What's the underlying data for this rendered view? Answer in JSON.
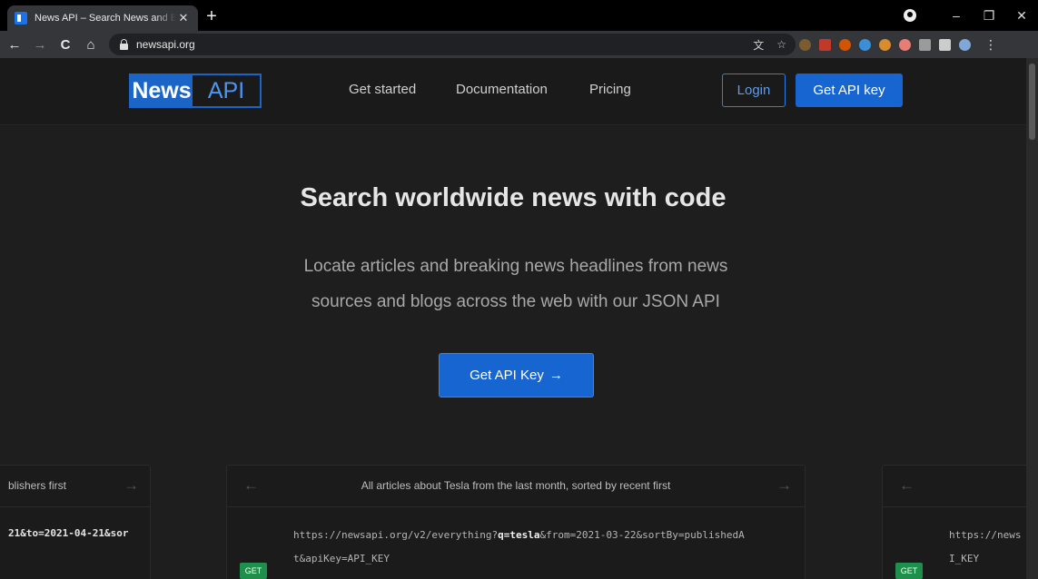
{
  "browser": {
    "tab_title": "News API – Search News and Blog articles on the web",
    "tab_close": "✕",
    "new_tab": "+",
    "url": "newsapi.org",
    "back": "←",
    "forward": "→",
    "reload": "C",
    "home": "⌂",
    "minimize": "–",
    "restore": "❐",
    "close": "✕",
    "translate_icon": "文",
    "star_icon": "☆",
    "menu": "⋮",
    "extension_colors": [
      "#7a5c2e",
      "#c0392b",
      "#d35400",
      "#3a8fd8",
      "#d98c2b",
      "#e67e73",
      "#9b9b9b",
      "#cccccc",
      "#7fa7d9"
    ]
  },
  "header": {
    "logo_news": "News",
    "logo_api": "API",
    "nav": [
      "Get started",
      "Documentation",
      "Pricing"
    ],
    "login": "Login",
    "get_api_key": "Get API key"
  },
  "hero": {
    "title": "Search worldwide news with code",
    "subtitle_line1": "Locate articles and breaking news headlines from news",
    "subtitle_line2": "sources and blogs across the web with our JSON API",
    "cta": "Get API Key",
    "cta_arrow": "→"
  },
  "examples": {
    "left": {
      "title": "blishers first",
      "arrow_right": "→",
      "code": "21&to=2021-04-21&sor"
    },
    "main": {
      "title": "All articles about Tesla from the last month, sorted by recent first",
      "arrow_left": "←",
      "arrow_right": "→",
      "method": "GET",
      "code_prefix": "https://newsapi.org/v2/everything?",
      "code_bold": "q=tesla",
      "code_suffix": "&from=2021-03-22&sortBy=publishedA",
      "code_line2": "t&apiKey=API_KEY"
    },
    "right": {
      "arrow_left": "←",
      "method": "GET",
      "code_line1": "https://news",
      "code_line2": "I_KEY"
    }
  }
}
